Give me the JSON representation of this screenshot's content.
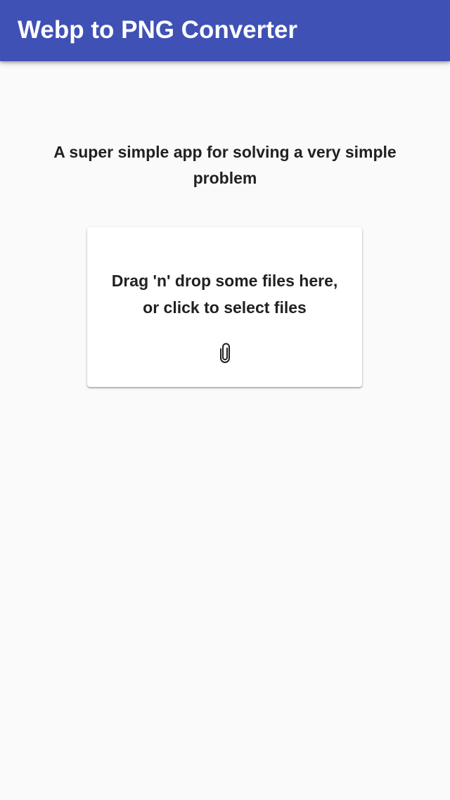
{
  "app_bar": {
    "title": "Webp to PNG Converter",
    "background_color": "#3f51b5"
  },
  "main": {
    "subtitle": "A super simple app for solving a very simple problem",
    "dropzone": {
      "line1": "Drag 'n' drop some files here,",
      "line2": "or click to select files",
      "icon": "paperclip-icon"
    }
  }
}
